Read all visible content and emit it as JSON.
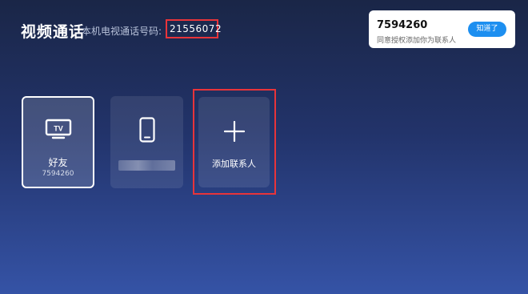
{
  "header": {
    "title": "视频通话",
    "subtitle": "本机电视通话号码:",
    "number": "21556072"
  },
  "toast": {
    "number": "7594260",
    "message": "同意授权添加你为联系人",
    "button_label": "知道了"
  },
  "contacts": [
    {
      "type": "tv",
      "icon": "tv-icon",
      "name": "好友",
      "id": "7594260",
      "selected": true
    },
    {
      "type": "phone",
      "icon": "phone-icon",
      "name": "",
      "id": ""
    }
  ],
  "add_contact": {
    "icon": "plus-icon",
    "label": "添加联系人"
  },
  "colors": {
    "highlight": "#e8343a",
    "accent": "#1d8ff0"
  }
}
